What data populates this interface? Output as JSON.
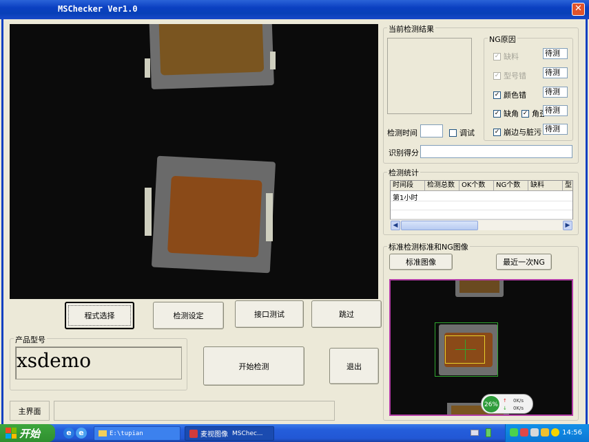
{
  "window": {
    "title": "MSChecker Ver1.0",
    "close_glyph": "✕"
  },
  "buttons": {
    "program_select": "程式选择",
    "detect_settings": "检测设定",
    "interface_test": "接口测试",
    "skip": "跳过",
    "start_detect": "开始检测",
    "exit": "退出",
    "standard_image": "标准图像",
    "last_ng": "最近一次NG"
  },
  "product_model": {
    "legend": "产品型号",
    "value": "xsdemo"
  },
  "status": {
    "main_screen": "主界面"
  },
  "current_result": {
    "legend": "当前检测结果",
    "detect_time_label": "检测时间",
    "debug_label": "调试",
    "score_label": "识别得分"
  },
  "ng_reasons": {
    "legend": "NG原因",
    "check_glyph": "✓",
    "items": [
      {
        "label": "缺料",
        "status": "待测",
        "disabled": true
      },
      {
        "label": "型号错",
        "status": "待测",
        "disabled": true
      },
      {
        "label": "颜色错",
        "status": "待测",
        "disabled": false
      },
      {
        "label": "缺角",
        "label2": "角歪",
        "status": "待测",
        "disabled": false
      },
      {
        "label": "崩边与脏污",
        "status": "待测",
        "disabled": false
      }
    ]
  },
  "stats": {
    "legend": "检测统计",
    "columns": [
      "时间段",
      "检测总数",
      "OK个数",
      "NG个数",
      "缺料",
      "型"
    ],
    "rows": [
      [
        "第1小时",
        "",
        "",
        "",
        "",
        ""
      ]
    ]
  },
  "standard_ng": {
    "legend": "标准检测标准和NG图像"
  },
  "net_monitor": {
    "percent": "26%",
    "up": "0K/s",
    "down": "0K/s"
  },
  "taskbar": {
    "start": "开始",
    "tasks": [
      "E:\\tupian",
      "麦视图像",
      "MSChec..."
    ],
    "clock": "14:56"
  },
  "colors": {
    "title_bar": "#0a3fc1",
    "ref_border": "#b43ca8",
    "ng_box": "#2fa82f",
    "target_box": "#e8d02a"
  }
}
